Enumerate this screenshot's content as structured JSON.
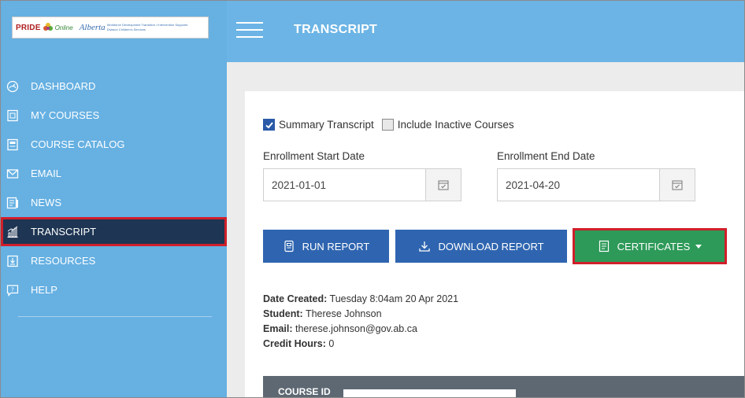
{
  "logo": {
    "brand": "PRIDE",
    "online": "Online",
    "org": "Alberta",
    "tagline": "Workforce Development Transition / Intervention Supports Division Children's Services"
  },
  "sidebar": {
    "items": [
      {
        "label": "DASHBOARD",
        "icon": "dashboard-icon"
      },
      {
        "label": "MY COURSES",
        "icon": "courses-icon"
      },
      {
        "label": "COURSE CATALOG",
        "icon": "catalog-icon"
      },
      {
        "label": "EMAIL",
        "icon": "email-icon"
      },
      {
        "label": "NEWS",
        "icon": "news-icon"
      },
      {
        "label": "TRANSCRIPT",
        "icon": "transcript-icon",
        "active": true
      },
      {
        "label": "RESOURCES",
        "icon": "resources-icon"
      },
      {
        "label": "HELP",
        "icon": "help-icon"
      }
    ]
  },
  "header": {
    "title": "TRANSCRIPT"
  },
  "options": {
    "summary_label": "Summary Transcript",
    "summary_checked": true,
    "inactive_label": "Include Inactive Courses",
    "inactive_checked": false
  },
  "dates": {
    "start_label": "Enrollment Start Date",
    "start_value": "2021-01-01",
    "end_label": "Enrollment End Date",
    "end_value": "2021-04-20"
  },
  "buttons": {
    "run": "RUN REPORT",
    "download": "DOWNLOAD REPORT",
    "certificates": "CERTIFICATES"
  },
  "report": {
    "date_created_label": "Date Created:",
    "date_created": "Tuesday 8:04am 20 Apr 2021",
    "student_label": "Student:",
    "student": "Therese Johnson",
    "email_label": "Email:",
    "email": "therese.johnson@gov.ab.ca",
    "credit_label": "Credit Hours:",
    "credit": "0"
  },
  "table": {
    "col1": "COURSE ID"
  },
  "colors": {
    "sidebar": "#66b0e2",
    "active_nav": "#1e3553",
    "primary_button": "#2f65b0",
    "success_button": "#2e9a59",
    "highlight": "#d01f2a"
  }
}
